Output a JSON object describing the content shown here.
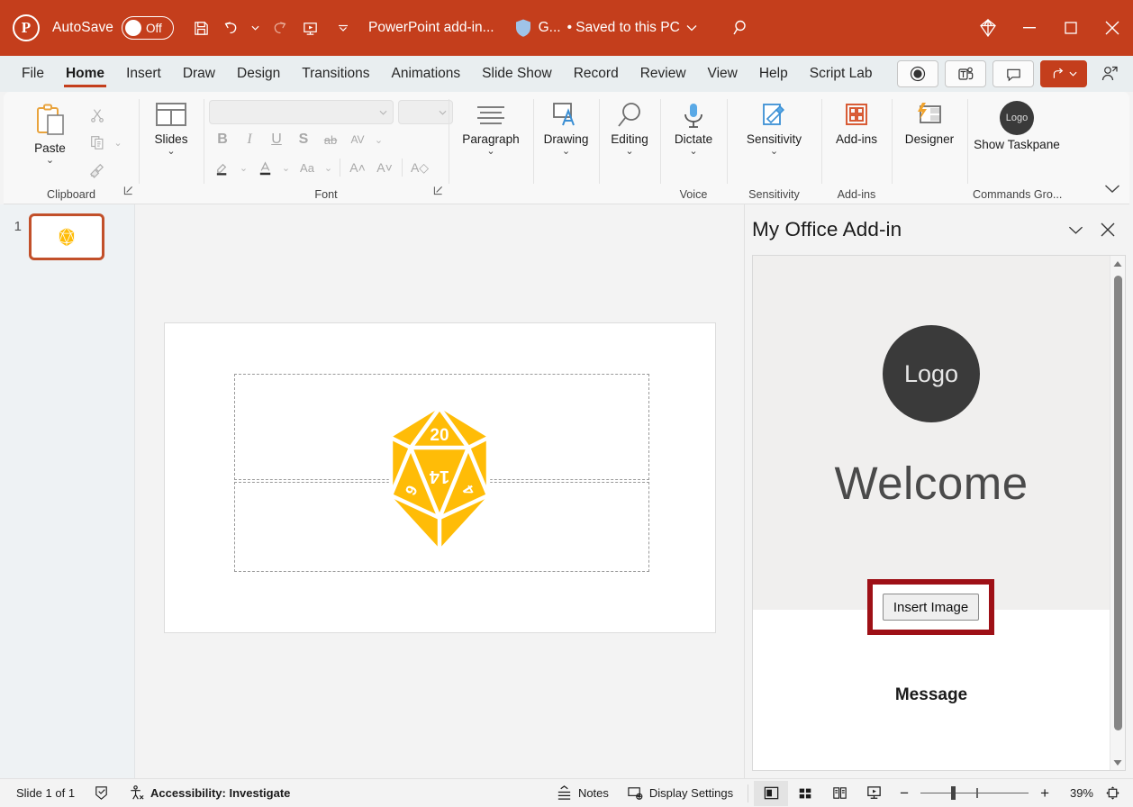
{
  "titlebar": {
    "app_logo": "powerpoint-logo",
    "autosave_label": "AutoSave",
    "autosave_state": "Off",
    "quick_access": [
      {
        "name": "save-icon",
        "tooltip": "Save"
      },
      {
        "name": "undo-icon",
        "tooltip": "Undo"
      },
      {
        "name": "undo-dropdown-icon",
        "tooltip": "Undo options"
      },
      {
        "name": "redo-icon",
        "tooltip": "Redo"
      },
      {
        "name": "start-presentation-icon",
        "tooltip": "Start From Beginning"
      },
      {
        "name": "customize-qat-icon",
        "tooltip": "Customize Quick Access Toolbar"
      }
    ],
    "document_title": "PowerPoint add-in...",
    "sensitivity_label": "G...",
    "save_state": "• Saved to this PC",
    "search_icon": "search-icon",
    "diamond_icon": "diamond-icon",
    "window_buttons": [
      "minimize",
      "maximize",
      "close"
    ]
  },
  "ribbon": {
    "tabs": [
      {
        "label": "File",
        "active": false
      },
      {
        "label": "Home",
        "active": true
      },
      {
        "label": "Insert",
        "active": false
      },
      {
        "label": "Draw",
        "active": false
      },
      {
        "label": "Design",
        "active": false
      },
      {
        "label": "Transitions",
        "active": false
      },
      {
        "label": "Animations",
        "active": false
      },
      {
        "label": "Slide Show",
        "active": false
      },
      {
        "label": "Record",
        "active": false
      },
      {
        "label": "Review",
        "active": false
      },
      {
        "label": "View",
        "active": false
      },
      {
        "label": "Help",
        "active": false
      },
      {
        "label": "Script Lab",
        "active": false
      }
    ],
    "tab_right_buttons": [
      {
        "name": "record-button",
        "icon": "record-circle-icon"
      },
      {
        "name": "teams-button",
        "icon": "teams-icon"
      },
      {
        "name": "comments-button",
        "icon": "comment-icon"
      },
      {
        "name": "share-button",
        "icon": "share-icon"
      },
      {
        "name": "present-to-people-button",
        "icon": "person-share-icon"
      }
    ],
    "groups": [
      {
        "name": "clipboard",
        "label": "Clipboard",
        "paste_label": "Paste",
        "items": [
          "cut-icon",
          "copy-icon",
          "format-painter-icon"
        ],
        "has_launcher": true
      },
      {
        "name": "slides",
        "label": "",
        "slides_label": "Slides"
      },
      {
        "name": "font",
        "label": "Font",
        "font_name_value": "",
        "font_size_value": "",
        "buttons": [
          "Bold",
          "Italic",
          "Underline",
          "Shadow",
          "Strikethrough",
          "Character Spacing",
          "Text Highlight Color",
          "Font Color",
          "Change Case",
          "Increase Font Size",
          "Decrease Font Size",
          "Clear All Formatting"
        ],
        "has_launcher": true
      },
      {
        "name": "paragraph",
        "label": "",
        "button_label": "Paragraph"
      },
      {
        "name": "drawing",
        "label": "",
        "button_label": "Drawing"
      },
      {
        "name": "editing",
        "label": "",
        "button_label": "Editing"
      },
      {
        "name": "voice",
        "label": "Voice",
        "button_label": "Dictate"
      },
      {
        "name": "sensitivity",
        "label": "Sensitivity",
        "button_label": "Sensitivity"
      },
      {
        "name": "add-ins",
        "label": "Add-ins",
        "button_label": "Add-ins"
      },
      {
        "name": "designer",
        "label": "",
        "button_label": "Designer"
      },
      {
        "name": "commands-group",
        "label": "Commands Gro...",
        "button_label": "Show Taskpane",
        "button_icon_text": "Logo"
      }
    ]
  },
  "slides_panel": {
    "slide_number": "1"
  },
  "slide": {
    "image_alt": "twenty-sided-die",
    "dice_color": "#FFBC07",
    "dice_numbers": [
      "20",
      "14",
      "6",
      "4"
    ],
    "placeholders": [
      "title-placeholder",
      "subtitle-placeholder"
    ]
  },
  "taskpane": {
    "title": "My Office Add-in",
    "collapse_icon": "chevron-down-icon",
    "close_icon": "close-icon",
    "logo_text": "Logo",
    "welcome_text": "Welcome",
    "insert_button_label": "Insert Image",
    "message_label": "Message",
    "highlight_color": "#9e1016",
    "scroll_up_icon": "scroll-up-arrow-icon",
    "scroll_down_icon": "scroll-down-arrow-icon"
  },
  "statusbar": {
    "slide_count": "Slide 1 of 1",
    "language_icon": "spell-check-icon",
    "accessibility_icon": "accessibility-icon",
    "accessibility_label": "Accessibility: Investigate",
    "notes_label": "Notes",
    "display_settings_label": "Display Settings",
    "views": [
      {
        "name": "normal-view-button",
        "active": true
      },
      {
        "name": "slide-sorter-view-button",
        "active": false
      },
      {
        "name": "reading-view-button",
        "active": false
      },
      {
        "name": "slide-show-button",
        "active": false
      }
    ],
    "zoom_out_label": "−",
    "zoom_in_label": "+",
    "zoom_percent": "39%",
    "fit_slide_icon": "fit-to-window-icon"
  }
}
